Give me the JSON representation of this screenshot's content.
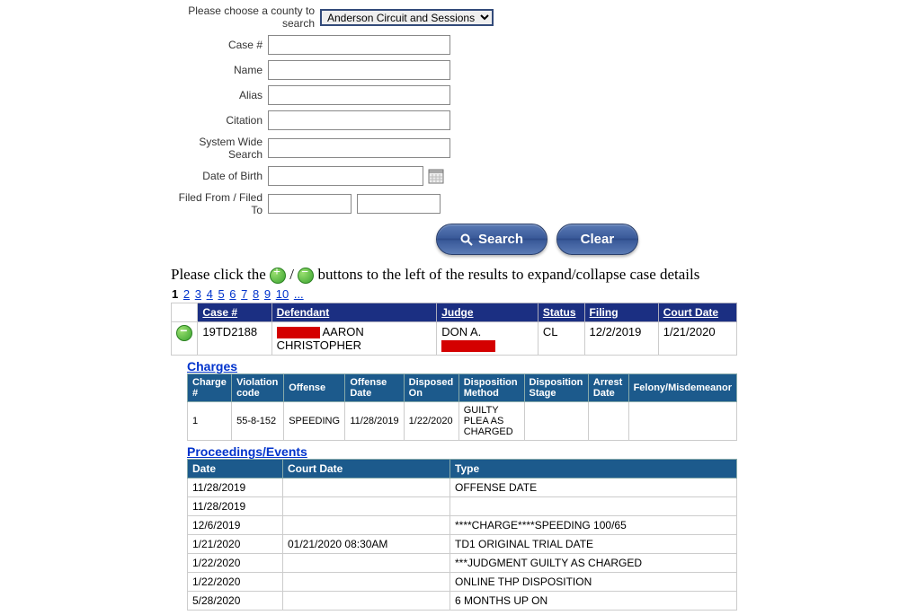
{
  "form": {
    "county_label": "Please choose a county to search",
    "county_selected": "Anderson Circuit and Sessions",
    "fields": {
      "case_no_label": "Case #",
      "name_label": "Name",
      "alias_label": "Alias",
      "citation_label": "Citation",
      "sws_label": "System Wide Search",
      "dob_label": "Date of Birth",
      "filed_label": "Filed From / Filed To"
    },
    "buttons": {
      "search": "Search",
      "clear": "Clear"
    }
  },
  "instructions": {
    "pre": "Please click the ",
    "mid": " / ",
    "post": " buttons to the left of the results to expand/collapse case details"
  },
  "pager": {
    "current": "1",
    "links": [
      "2",
      "3",
      "4",
      "5",
      "6",
      "7",
      "8",
      "9",
      "10",
      "..."
    ]
  },
  "results": {
    "headers": {
      "case_no": "Case #",
      "defendant": "Defendant",
      "judge": "Judge",
      "status": "Status",
      "filing": "Filing",
      "court_date": "Court Date"
    },
    "row": {
      "case_no": "19TD2188",
      "defendant_rest": " AARON CHRISTOPHER",
      "judge_pre": "DON A. ",
      "status": "CL",
      "filing": "12/2/2019",
      "court_date": "1/21/2020"
    }
  },
  "charges": {
    "title": "Charges",
    "headers": {
      "charge_no": "Charge #",
      "violation": "Violation code",
      "offense": "Offense",
      "offense_date": "Offense Date",
      "disposed": "Disposed On",
      "method": "Disposition Method",
      "stage": "Disposition Stage",
      "arrest": "Arrest Date",
      "fm": "Felony/Misdemeanor"
    },
    "row": {
      "charge_no": "1",
      "violation": "55-8-152",
      "offense": "SPEEDING",
      "offense_date": "11/28/2019",
      "disposed": "1/22/2020",
      "method": "GUILTY PLEA AS CHARGED",
      "stage": "",
      "arrest": "",
      "fm": ""
    }
  },
  "events": {
    "title": "Proceedings/Events",
    "headers": {
      "date": "Date",
      "court_date": "Court Date",
      "type": "Type"
    },
    "rows": [
      {
        "date": "11/28/2019",
        "court_date": "",
        "type": "OFFENSE DATE"
      },
      {
        "date": "11/28/2019",
        "court_date": "",
        "type": ""
      },
      {
        "date": "12/6/2019",
        "court_date": "",
        "type": "****CHARGE****SPEEDING 100/65"
      },
      {
        "date": "1/21/2020",
        "court_date": "01/21/2020 08:30AM",
        "type": "TD1 ORIGINAL TRIAL DATE"
      },
      {
        "date": "1/22/2020",
        "court_date": "",
        "type": "***JUDGMENT GUILTY AS CHARGED"
      },
      {
        "date": "1/22/2020",
        "court_date": "",
        "type": "ONLINE THP DISPOSITION"
      },
      {
        "date": "5/28/2020",
        "court_date": "",
        "type": "6 MONTHS UP ON"
      }
    ]
  }
}
